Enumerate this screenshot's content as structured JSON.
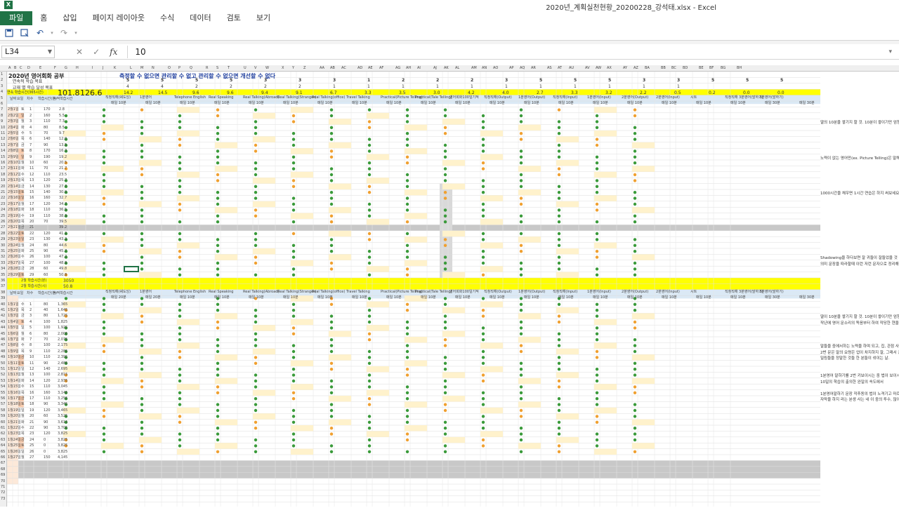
{
  "window": {
    "title": "2020년_계획실천현황_20200228_강석태.xlsx - Excel"
  },
  "ribbon": {
    "tabs": [
      "파일",
      "홈",
      "삽입",
      "페이지 레이아웃",
      "수식",
      "데이터",
      "검토",
      "보기"
    ]
  },
  "formula_bar": {
    "name_box": "L34",
    "value": "10",
    "fx": "fx"
  },
  "sheet": {
    "title": "2020년 영어회화 공부",
    "motto": "측정할 수 없으면 관리할 수 없고 관리할 수 없으면 개선할 수 없다",
    "labels": {
      "goal_row": "연속적 학습 목표",
      "weekly_row": "교재 별 학습 달성 목표",
      "cumulative_row": "연속 학습시간(365시간)"
    },
    "totals": {
      "hours_a": "101.8",
      "hours_b": "126.6"
    },
    "sum_labels": [
      "2월 학습시간(분)",
      "2월 학습시간(시)"
    ],
    "sum_values": [
      "3050",
      "50.8"
    ],
    "goal_values": [
      "5",
      "5",
      "5",
      "5",
      "3",
      "3",
      "3",
      "1",
      "2",
      "2",
      "2",
      "3",
      "5",
      "5",
      "5",
      "3",
      "3",
      "5",
      "5",
      "5",
      "1",
      "1"
    ],
    "weekly_values": [
      "4",
      "4",
      "2",
      "2",
      "2",
      "2",
      "1",
      "1",
      "1",
      "1",
      "1",
      "1",
      "1",
      "1",
      "1",
      "1",
      "1"
    ],
    "rate_values": [
      "14.2",
      "14.5",
      "9.6",
      "9.6",
      "9.4",
      "9.1",
      "6.7",
      "3.3",
      "3.5",
      "3.0",
      "4.2",
      "4.0",
      "2.7",
      "3.3",
      "3.2",
      "2.2",
      "0.5",
      "0.2",
      "0.0",
      "0.0"
    ],
    "headers_top": [
      "날짜",
      "요일",
      "차수",
      "학습시간(분)",
      "누적학습시간",
      "직청직해(쉐도잉)",
      "1분영어",
      "Telephone English",
      "Real Speaking",
      "Real Talking(Abroad)",
      "Real Talking(Stranger)",
      "Real Talking(office)",
      "Travel Talking",
      "Practical(Picture Telling)",
      "Practical(Tale Telling)",
      "영어회화100일기적",
      "직청직해(Output)",
      "1분영어(Output)",
      "직청직해(Input)",
      "1분영어(Input)",
      "2분영어(Output)",
      "2분영어(Input)",
      "시트",
      "직청직해 3분영어(말하기)",
      "3분영어(말하기)"
    ],
    "headers_sub": [
      "매일 10분",
      "매일 10분",
      "매일 10분",
      "매일 10분",
      "매일 10분",
      "매일 10분",
      "매일 10분",
      "매일 10분",
      "매일 10분",
      "매일 10분",
      "매일 10분",
      "매일 10분",
      "매일 10분",
      "매일 10분",
      "매일 10분",
      "매일 10분",
      "매일 10분",
      "매일 10분",
      "매일 10분",
      "매일 30분",
      "매일 30분"
    ],
    "headers_sub2": [
      "매일 20분",
      "매일 20분",
      "매일 10분",
      "매일 10분",
      "매일 10분",
      "매일 10분",
      "매일 10분",
      "매일 10분",
      "매일 10분",
      "매일 10분",
      "매일 10분",
      "매일 10분",
      "매일 10분",
      "매일 10분",
      "매일 10분",
      "매일 10분",
      "매일 10분",
      "매일 10분",
      "매일 10분",
      "매일 30분",
      "매일 30분"
    ],
    "notes": [
      "딸의 10분을 쌓기지 할 것. 10분이 쌓이기만 엄청 지치셔도",
      "노력이 없는 영어만(ex. Picture Telling)은 말해볼 예정시기",
      "1000시간을 채우면 1시간 연습은 하지 써보세요",
      "Shadowing을 하다보면 잘 귀들이 잘들었을 것 같다",
      "의미 문장을 따라할때 이런 저런 문자으로 정리해야지 잘 맞다",
      "딸이 10분을 쌓기지 할 것. 10분이 쌓이기만 엄청 지치셔도",
      "작년에 영어 문소리의 독음부터 하여 작당한 현을 어떻게 정리",
      "말들을 중에서하는 노력을 하며 되고, 집, 관점 사용 명백히 말",
      "2번 문은 말의 요령은 업이 차지하지 잘, 그래서 공이 공이 말",
      "밀림들을 정말한 것들 한 분들이 섞이는 날.",
      "1분영어 말하기를 2번 키보이시는 중 법이 보이시는",
      "10일의 학습의 출의한 완일의 속도에서",
      "1분영어말하기 문장 작추동의 법이 노격기고 마르지 말들 수 있",
      "자막을 하지 라는 분생 사는 네 이 중의 투수, 많이 부었다"
    ],
    "dates": [
      "2월1일",
      "2월2일",
      "2월3일",
      "2월4일",
      "2월5일",
      "2월6일",
      "2월7일",
      "2월8일",
      "2월9일",
      "2월10일",
      "2월11일",
      "2월12일",
      "2월13일",
      "2월14일",
      "2월15일",
      "2월16일",
      "2월17일",
      "2월18일",
      "2월19일",
      "2월20일",
      "2월21일",
      "2월22일",
      "2월23일",
      "2월24일",
      "2월25일",
      "2월26일",
      "2월27일",
      "2월28일",
      "2월29일"
    ],
    "days": [
      "토",
      "일",
      "월",
      "화",
      "수",
      "목",
      "금",
      "토",
      "일",
      "월",
      "화",
      "수",
      "목",
      "금",
      "토",
      "일",
      "월",
      "화",
      "수",
      "목",
      "금",
      "토",
      "일",
      "월",
      "화",
      "수",
      "목",
      "금",
      "토"
    ],
    "minutes": [
      "170",
      "160",
      "110",
      "80",
      "70",
      "140",
      "90",
      "170",
      "190",
      "60",
      "70",
      "110",
      "120",
      "130",
      "140",
      "160",
      "120",
      "110",
      "110",
      "70",
      "",
      "120",
      "130",
      "80",
      "90",
      "100",
      "100",
      "60",
      "60"
    ],
    "cum_hours": [
      "2.8",
      "5.5",
      "7.3",
      "8.5",
      "9.7",
      "12.0",
      "13.5",
      "16.3",
      "19.2",
      "20.5",
      "21.7",
      "23.5",
      "25.7",
      "27.7",
      "30.0",
      "32.7",
      "34.7",
      "36.5",
      "38.3",
      "39.5",
      "39.2",
      "41.2",
      "43.3",
      "44.6",
      "45.7",
      "47.2",
      "48.8",
      "49.8",
      "50.8"
    ],
    "dates2": [
      "1월1일",
      "1월2일",
      "1월3일",
      "1월4일",
      "1월5일",
      "1월6일",
      "1월7일",
      "1월8일",
      "1월9일",
      "1월10일",
      "1월11일",
      "1월12일",
      "1월13일",
      "1월14일",
      "1월15일",
      "1월16일",
      "1월17일",
      "1월18일",
      "1월19일",
      "1월20일",
      "1월21일",
      "1월22일",
      "1월23일",
      "1월24일",
      "1월25일",
      "1월26일",
      "1월27일"
    ],
    "days2": [
      "수",
      "목",
      "금",
      "토",
      "일",
      "월",
      "화",
      "수",
      "목",
      "금",
      "토",
      "일",
      "월",
      "화",
      "수",
      "목",
      "금",
      "토",
      "일",
      "월",
      "화",
      "수",
      "목",
      "금",
      "토",
      "일",
      "월"
    ],
    "minutes2": [
      "80",
      "40",
      "80",
      "100",
      "100",
      "80",
      "70",
      "100",
      "110",
      "110",
      "90",
      "140",
      "100",
      "120",
      "110",
      "160",
      "110",
      "90",
      "120",
      "60",
      "90",
      "90",
      "120",
      "0",
      "0",
      "0",
      "150"
    ],
    "cum2": [
      "1,365",
      "1,645",
      "1,725",
      "1,825",
      "1,925",
      "2,005",
      "2,075",
      "2,175",
      "2,285",
      "2,395",
      "2,485",
      "2,695",
      "2,815",
      "2,935",
      "3,045",
      "3,145",
      "3,255",
      "3,345",
      "3,465",
      "3,525",
      "3,615",
      "3,705",
      "3,825",
      "3,825",
      "3,825",
      "3,825",
      "4,145"
    ]
  }
}
